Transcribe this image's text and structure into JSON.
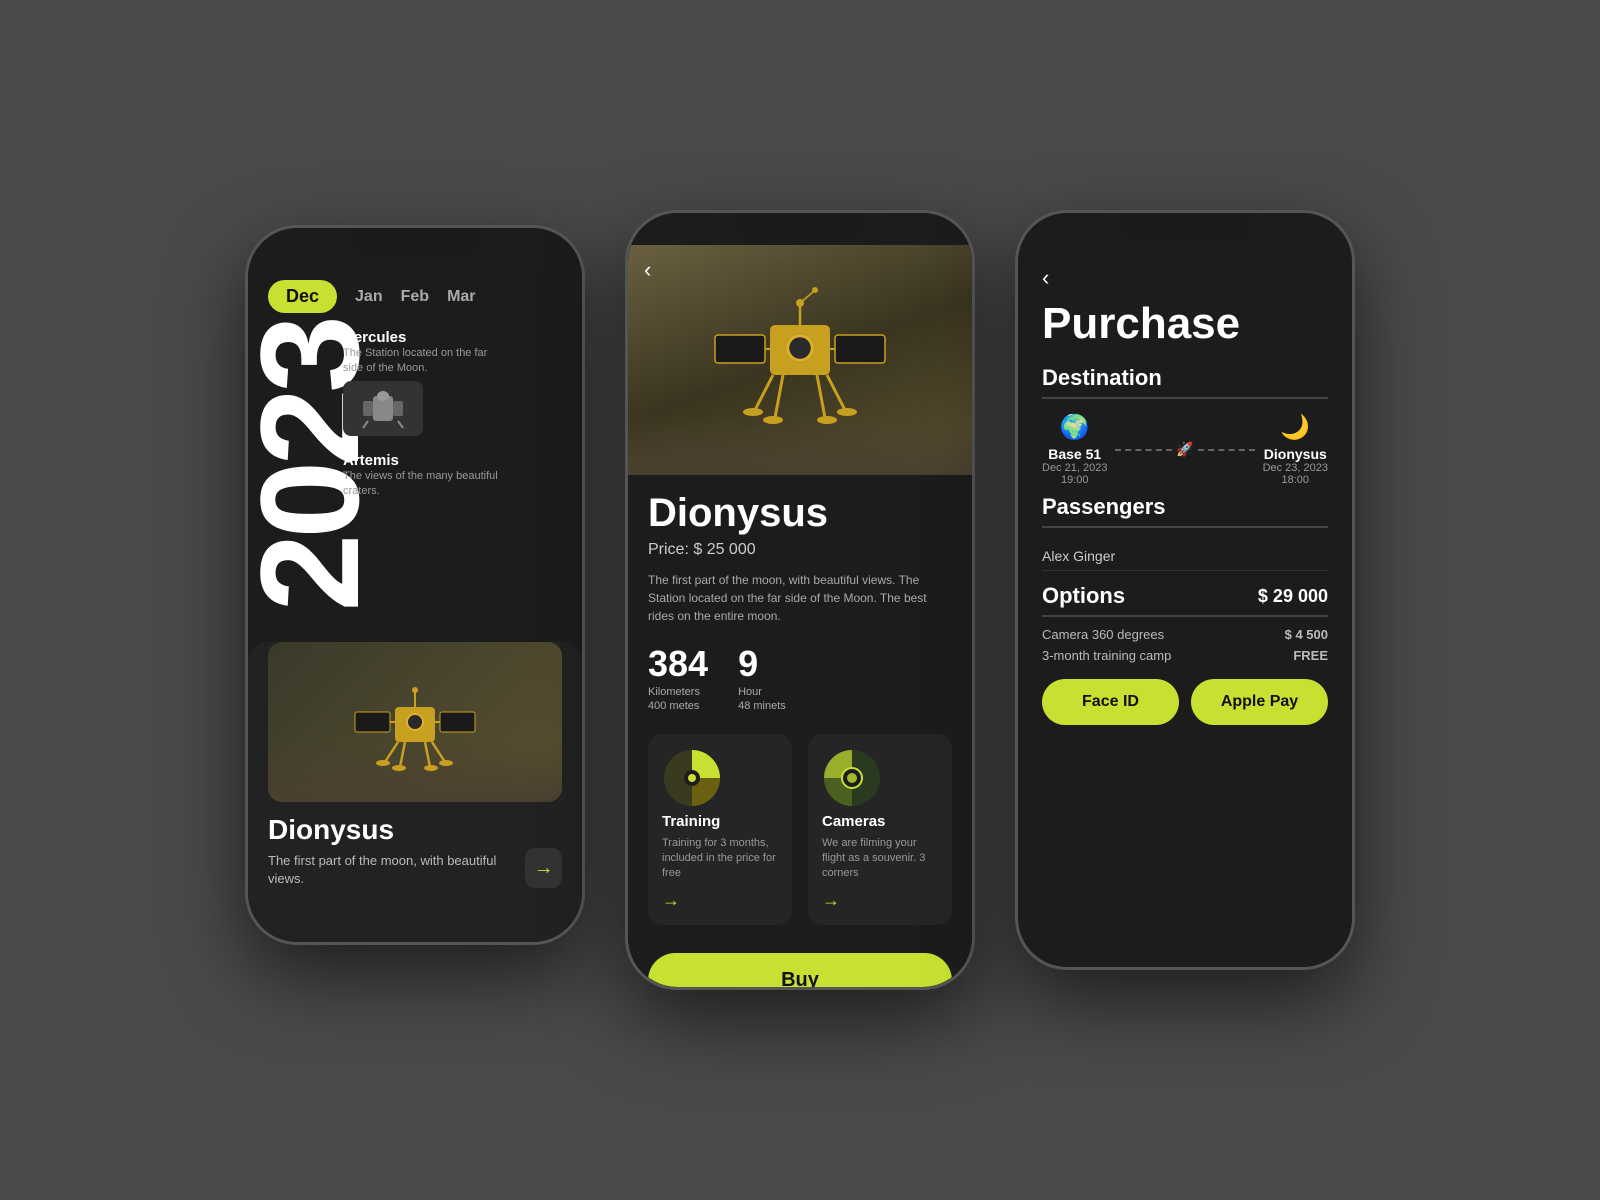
{
  "phone1": {
    "months": {
      "active": "Dec",
      "others": [
        "Jan",
        "Feb",
        "Mar"
      ]
    },
    "year": "2023",
    "missions": [
      {
        "name": "Hercules",
        "description": "The Station located on the far side of the Moon."
      },
      {
        "name": "Artemis",
        "description": "The views of the many beautiful craters."
      }
    ],
    "featured": {
      "title": "Dionysus",
      "description": "The first part of the moon, with beautiful views.",
      "arrow": "→"
    }
  },
  "phone2": {
    "back_icon": "‹",
    "title": "Dionysus",
    "price": "Price: $ 25 000",
    "description": "The first part of the moon, with beautiful views. The Station located on the far side of the Moon. The best rides on the entire moon.",
    "stats": [
      {
        "value": "384",
        "label": "Kilometers\n400 metes"
      },
      {
        "value": "9",
        "label": "Hour\n48 minets"
      }
    ],
    "features": [
      {
        "name": "Training",
        "description": "Training for 3 months, included in the price for free",
        "arrow": "→"
      },
      {
        "name": "Cameras",
        "description": "We are filming your flight as a souvenir. 3 corners",
        "arrow": "→"
      }
    ],
    "buy_button": "Buy"
  },
  "phone3": {
    "back_icon": "‹",
    "title": "Purchase",
    "destination_label": "Destination",
    "route": {
      "from": {
        "icon": "🌍",
        "name": "Base 51",
        "date": "Dec 21, 2023",
        "time": "19:00"
      },
      "to": {
        "icon": "🌙",
        "name": "Dionysus",
        "date": "Dec 23, 2023",
        "time": "18:00"
      }
    },
    "passengers_label": "Passengers",
    "passenger_name": "Alex Ginger",
    "options_label": "Options",
    "options_total": "$ 29 000",
    "options": [
      {
        "name": "Camera 360 degrees",
        "price": "$ 4 500"
      },
      {
        "name": "3-month training camp",
        "price": "FREE"
      }
    ],
    "buttons": {
      "face_id": "Face ID",
      "apple_pay": "Apple Pay"
    }
  }
}
